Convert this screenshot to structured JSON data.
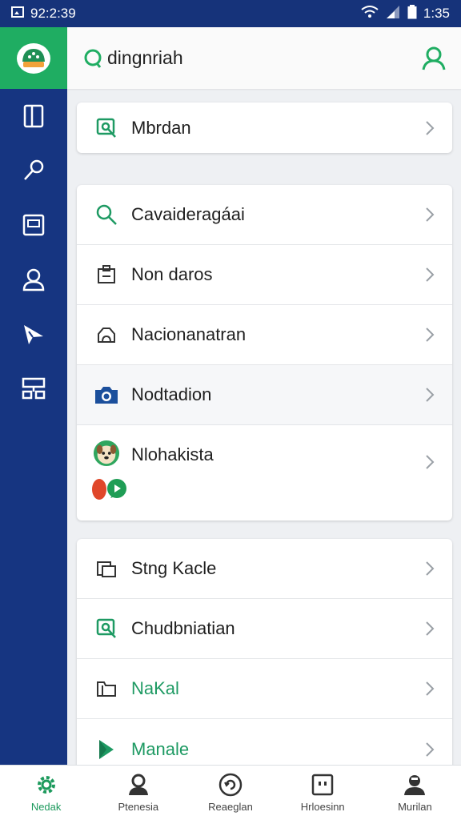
{
  "status_bar": {
    "left_time": "92:2:39",
    "right_time": "1:35"
  },
  "header": {
    "title": "dingnriah"
  },
  "cards": [
    {
      "rows": [
        {
          "label": "Mbrdan",
          "icon": "search-doc-icon"
        }
      ]
    },
    {
      "rows": [
        {
          "label": "Cavaideragáai",
          "icon": "search-icon"
        },
        {
          "label": "Non daros",
          "icon": "clipboard-icon"
        },
        {
          "label": "Nacionanatran",
          "icon": "cloud-icon"
        },
        {
          "label": "Nodtadion",
          "icon": "camera-icon"
        },
        {
          "label": "Nlohakista",
          "icon": "dog-avatar-icon"
        }
      ]
    },
    {
      "rows": [
        {
          "label": "Stng Kacle",
          "icon": "copy-icon"
        },
        {
          "label": "Chudbniatian",
          "icon": "search-doc-icon"
        },
        {
          "label": "NaKal",
          "icon": "folder-icon"
        },
        {
          "label": "Manale",
          "icon": "play-icon"
        }
      ]
    }
  ],
  "bottom_nav": [
    {
      "label": "Nedak",
      "icon": "gear-icon",
      "active": true
    },
    {
      "label": "Ptenesia",
      "icon": "person-icon",
      "active": false
    },
    {
      "label": "Reaeglan",
      "icon": "refresh-icon",
      "active": false
    },
    {
      "label": "Hrloesinn",
      "icon": "device-icon",
      "active": false
    },
    {
      "label": "Murilan",
      "icon": "user-icon",
      "active": false
    }
  ],
  "colors": {
    "accent": "#1fad62",
    "rail": "#163581",
    "status_bar": "#16337a",
    "active_nav": "#1d9a5d"
  }
}
